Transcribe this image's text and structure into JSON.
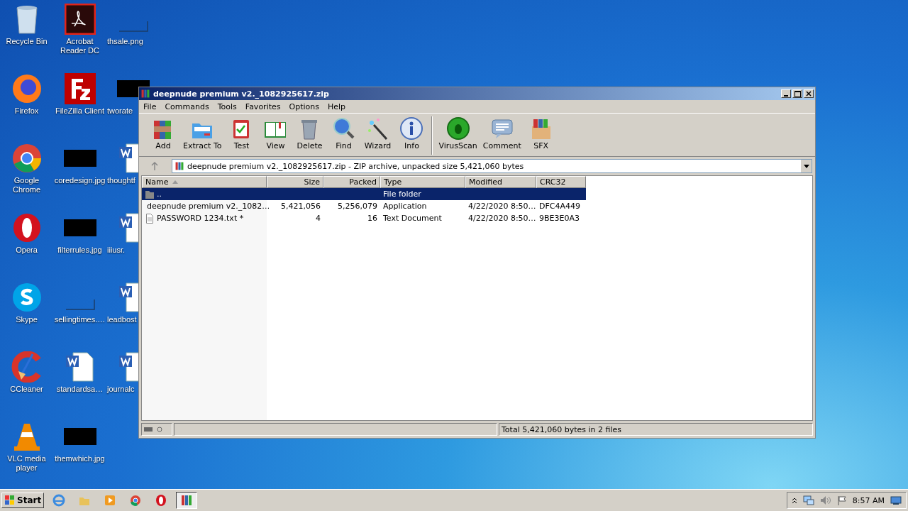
{
  "desktop": {
    "icons": [
      {
        "label": "Recycle Bin",
        "kind": "recycle"
      },
      {
        "label": "Acrobat Reader DC",
        "kind": "acrobat"
      },
      {
        "label": "thsale.png",
        "kind": "blank"
      },
      {
        "label": "Firefox",
        "kind": "firefox"
      },
      {
        "label": "FileZilla Client",
        "kind": "filezilla"
      },
      {
        "label": "tworate",
        "kind": "thumb"
      },
      {
        "label": "Google Chrome",
        "kind": "chrome"
      },
      {
        "label": "coredesign.jpg",
        "kind": "thumb"
      },
      {
        "label": "thoughtf",
        "kind": "word"
      },
      {
        "label": "Opera",
        "kind": "opera"
      },
      {
        "label": "filterrules.jpg",
        "kind": "thumb"
      },
      {
        "label": "iiiusr.",
        "kind": "word"
      },
      {
        "label": "Skype",
        "kind": "skype"
      },
      {
        "label": "sellingtimes.…",
        "kind": "blank"
      },
      {
        "label": "leadbost",
        "kind": "word"
      },
      {
        "label": "CCleaner",
        "kind": "ccleaner"
      },
      {
        "label": "standardsa…",
        "kind": "word"
      },
      {
        "label": "journalc",
        "kind": "word"
      },
      {
        "label": "VLC media player",
        "kind": "vlc"
      },
      {
        "label": "themwhich.jpg",
        "kind": "thumb"
      }
    ]
  },
  "window": {
    "title": "deepnude premium v2._1082925617.zip",
    "menu": [
      "File",
      "Commands",
      "Tools",
      "Favorites",
      "Options",
      "Help"
    ],
    "toolbar": [
      [
        {
          "label": "Add",
          "kind": "add"
        },
        {
          "label": "Extract To",
          "kind": "extract"
        },
        {
          "label": "Test",
          "kind": "test"
        },
        {
          "label": "View",
          "kind": "view"
        },
        {
          "label": "Delete",
          "kind": "delete"
        },
        {
          "label": "Find",
          "kind": "find"
        },
        {
          "label": "Wizard",
          "kind": "wizard"
        },
        {
          "label": "Info",
          "kind": "info"
        }
      ],
      [
        {
          "label": "VirusScan",
          "kind": "virus"
        },
        {
          "label": "Comment",
          "kind": "comment"
        },
        {
          "label": "SFX",
          "kind": "sfx"
        }
      ]
    ],
    "path": "deepnude premium v2._1082925617.zip - ZIP archive, unpacked size 5,421,060 bytes",
    "columns": [
      "Name",
      "Size",
      "Packed",
      "Type",
      "Modified",
      "CRC32"
    ],
    "rows": [
      {
        "kind": "folder",
        "name": "..",
        "size": "",
        "packed": "",
        "type": "File folder",
        "modified": "",
        "crc": "",
        "selected": true
      },
      {
        "kind": "app",
        "name": "deepnude premium v2._1082…",
        "size": "5,421,056",
        "packed": "5,256,079",
        "type": "Application",
        "modified": "4/22/2020 8:50…",
        "crc": "DFC4A449",
        "selected": false
      },
      {
        "kind": "text",
        "name": "PASSWORD 1234.txt *",
        "size": "4",
        "packed": "16",
        "type": "Text Document",
        "modified": "4/22/2020 8:50…",
        "crc": "9BE3E0A3",
        "selected": false
      }
    ],
    "status": "Total 5,421,060 bytes in 2 files"
  },
  "taskbar": {
    "start": "Start",
    "apps": [
      {
        "kind": "ie",
        "selected": false
      },
      {
        "kind": "explorer",
        "selected": false
      },
      {
        "kind": "media",
        "selected": false
      },
      {
        "kind": "chrome",
        "selected": false
      },
      {
        "kind": "opera",
        "selected": false
      },
      {
        "kind": "winrar",
        "selected": true
      }
    ],
    "time": "8:57 AM"
  }
}
